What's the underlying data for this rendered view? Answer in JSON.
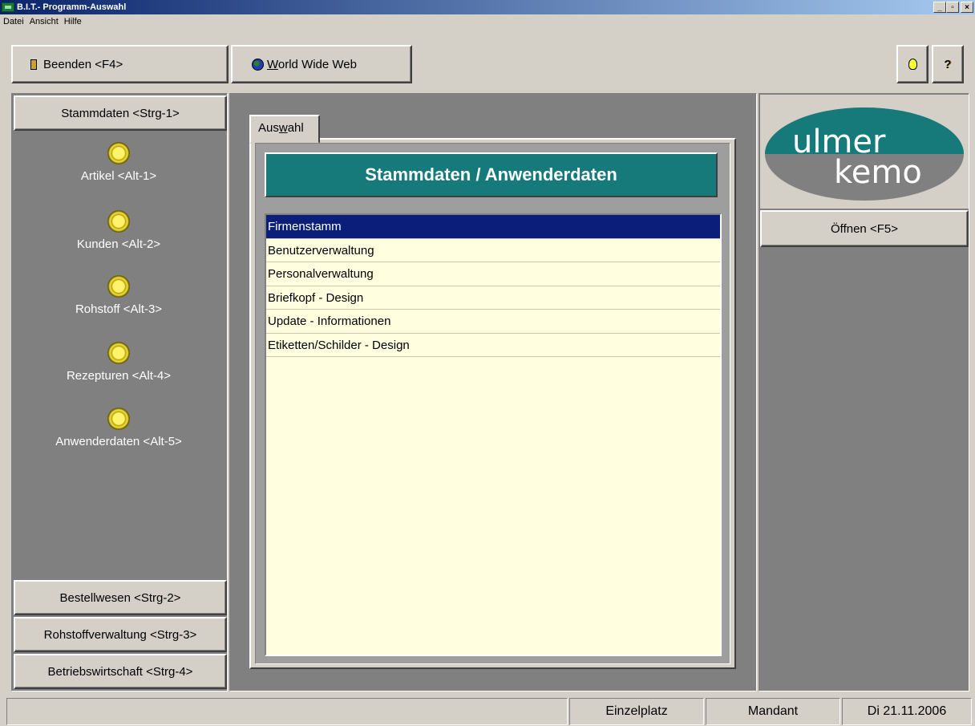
{
  "window": {
    "title": "B.I.T.- Programm-Auswahl",
    "controls": [
      "_",
      "▫",
      "×"
    ]
  },
  "menu": [
    "Datei",
    "Ansicht",
    "Hilfe"
  ],
  "toolbar": {
    "exit_label": "Beenden <F4>",
    "www_label": "World Wide Web",
    "www_mnemonic": "W",
    "www_rest": "orld Wide Web"
  },
  "nav": {
    "stammdaten": "Stammdaten <Strg-1>",
    "items": [
      {
        "label": "Artikel <Alt-1>",
        "icon": "gear-icon"
      },
      {
        "label": "Kunden <Alt-2>",
        "icon": "gear-icon"
      },
      {
        "label": "Rohstoff <Alt-3>",
        "icon": "gear-icon"
      },
      {
        "label": "Rezepturen <Alt-4>",
        "icon": "gear-icon"
      },
      {
        "label": "Anwenderdaten <Alt-5>",
        "icon": "gear-icon"
      }
    ],
    "bestellwesen": "Bestellwesen <Strg-2>",
    "rohstoffverwaltung": "Rohstoffverwaltung <Strg-3>",
    "betriebswirtschaft": "Betriebswirtschaft <Strg-4>"
  },
  "tab": {
    "label_pre": "Aus",
    "label_mnemonic": "w",
    "label_post": "ahl"
  },
  "main": {
    "header": "Stammdaten / Anwenderdaten",
    "list": [
      "Firmenstamm",
      "Benutzerverwaltung",
      "Personalverwaltung",
      "Briefkopf - Design",
      "Update - Informationen",
      "Etiketten/Schilder - Design"
    ],
    "selected_index": 0
  },
  "logo": {
    "line1": "ulmer",
    "line2": "kemo"
  },
  "right": {
    "open_label": "Öffnen <F5>"
  },
  "status": {
    "mode": "Einzelplatz",
    "mandant": "Mandant",
    "date": "Di 21.11.2006"
  },
  "colors": {
    "accent_teal": "#167a7a",
    "selection": "#0a1e7a",
    "list_bg": "#ffffe0"
  }
}
